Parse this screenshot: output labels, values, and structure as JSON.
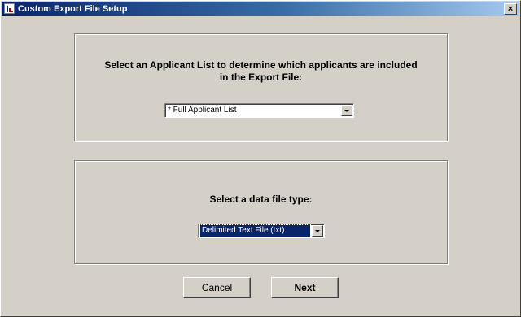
{
  "window": {
    "title": "Custom Export File Setup",
    "close_label": "×"
  },
  "applicant_section": {
    "prompt_line1": "Select an Applicant List to determine which applicants are included",
    "prompt_line2": "in the Export File:",
    "selected_list": "* Full Applicant List"
  },
  "filetype_section": {
    "prompt": "Select a data file type:",
    "selected_type": "Delimited Text File (txt)"
  },
  "buttons": {
    "cancel": "Cancel",
    "next": "Next"
  }
}
